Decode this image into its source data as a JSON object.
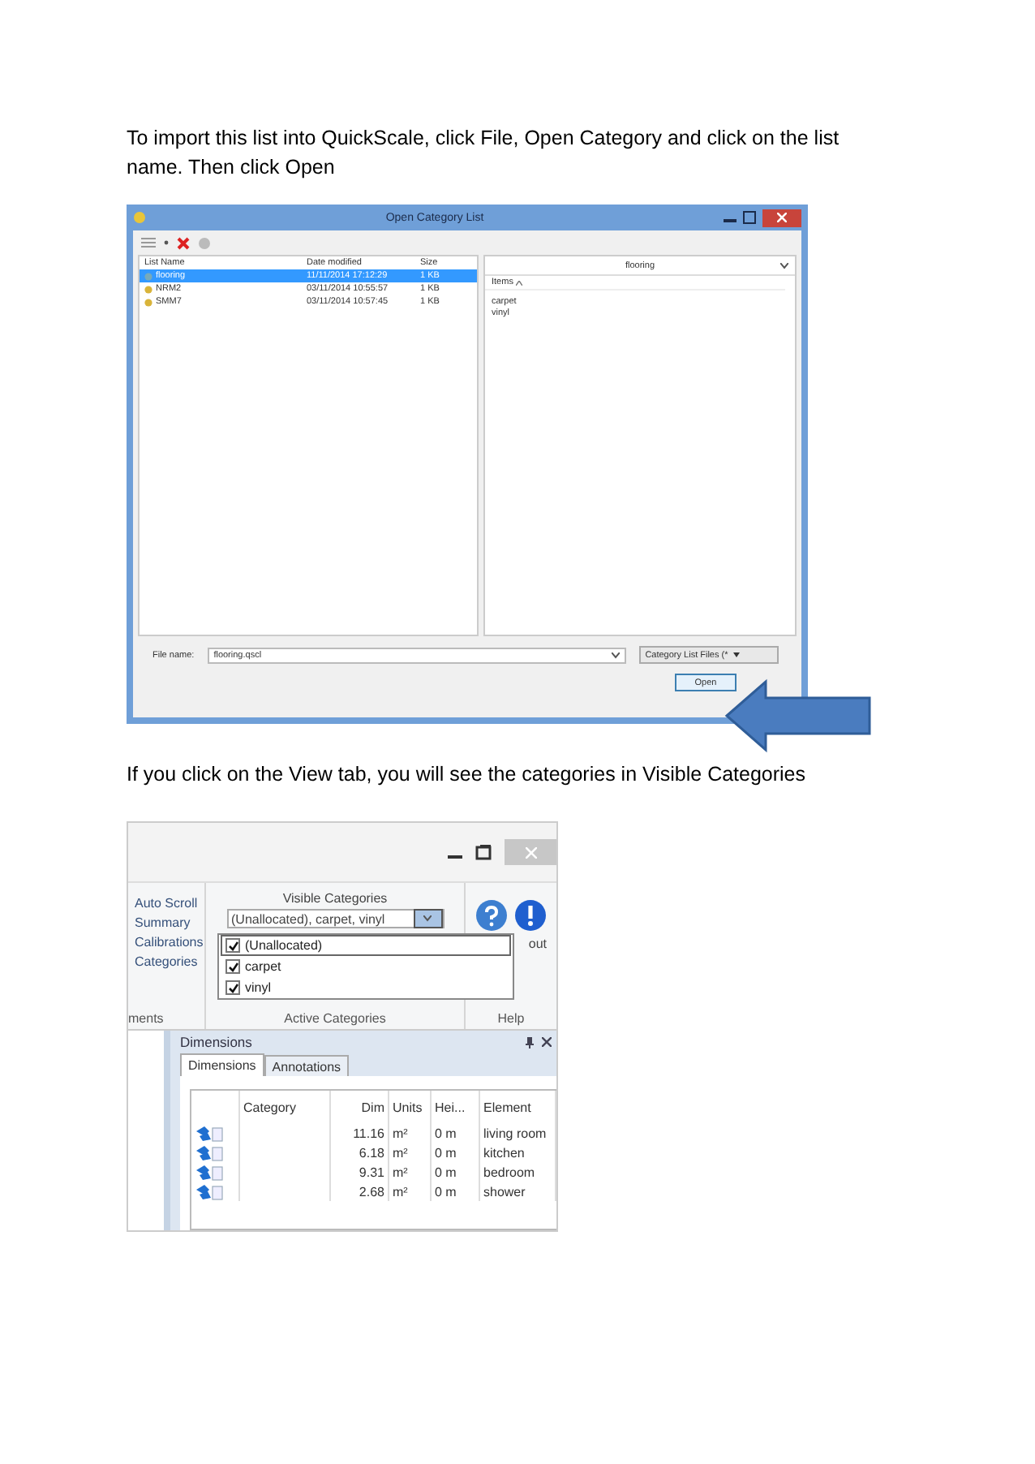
{
  "paragraphs": [
    "To import this list into QuickScale, click File, Open Category and click on the list name. Then click Open",
    "If you click on the View tab, you will see the categories in Visible Categories"
  ],
  "open_dialog": {
    "title": "Open Category List",
    "columns": [
      "List Name",
      "Date modified",
      "Size"
    ],
    "rows": [
      {
        "name": "flooring",
        "date": "11/11/2014 17:12:29",
        "size": "1 KB",
        "selected": true
      },
      {
        "name": "NRM2",
        "date": "03/11/2014 10:55:57",
        "size": "1 KB",
        "selected": false
      },
      {
        "name": "SMM7",
        "date": "03/11/2014 10:57:45",
        "size": "1 KB",
        "selected": false
      }
    ],
    "preview": {
      "header": "flooring",
      "column": "Items",
      "items": [
        "carpet",
        "vinyl"
      ]
    },
    "file_name_label": "File name:",
    "file_name": "flooring.qscl",
    "filter": "Category List Files (*",
    "open_button": "Open"
  },
  "app_window": {
    "ribbon_items": [
      "Auto Scroll",
      "Summary",
      "Calibrations",
      "Categories"
    ],
    "group_labels": [
      "ments",
      "Active Categories",
      "Help"
    ],
    "visible_categories": {
      "label": "Visible Categories",
      "value": "(Unallocated), carpet, vinyl",
      "options": [
        {
          "label": "(Unallocated)",
          "checked": true,
          "selected": true
        },
        {
          "label": "carpet",
          "checked": true,
          "selected": false
        },
        {
          "label": "vinyl",
          "checked": true,
          "selected": false
        }
      ]
    },
    "help_fragment": "out",
    "panel": {
      "title": "Dimensions",
      "tabs": [
        {
          "label": "Dimensions",
          "selected": true
        },
        {
          "label": "Annotations",
          "selected": false
        }
      ],
      "columns": [
        "Category",
        "Dim",
        "Units",
        "Hei...",
        "Element"
      ],
      "rows": [
        {
          "dim": "11.16",
          "units": "m²",
          "height": "0 m",
          "element": "living room"
        },
        {
          "dim": "6.18",
          "units": "m²",
          "height": "0 m",
          "element": "kitchen"
        },
        {
          "dim": "9.31",
          "units": "m²",
          "height": "0 m",
          "element": "bedroom"
        },
        {
          "dim": "2.68",
          "units": "m²",
          "height": "0 m",
          "element": "shower"
        }
      ]
    }
  }
}
